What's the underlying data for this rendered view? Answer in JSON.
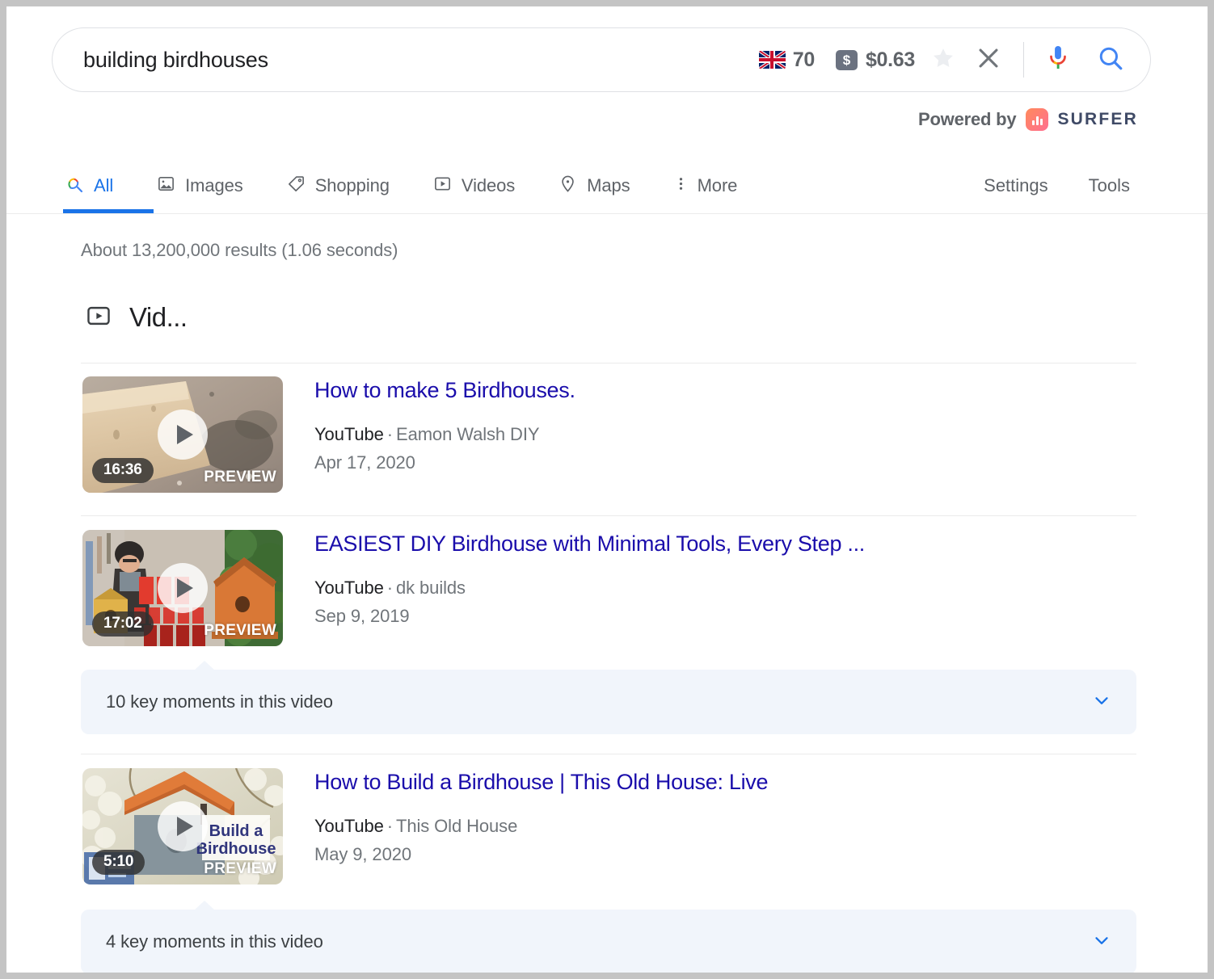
{
  "search": {
    "query": "building birdhouses",
    "placeholder": "Search",
    "metrics": {
      "flag_label": "70",
      "price_label": "$0.63",
      "dollar_glyph": "$"
    }
  },
  "powered_by": {
    "prefix": "Powered by",
    "brand": "SURFER"
  },
  "nav": {
    "tabs": [
      {
        "label": "All",
        "icon": "google-search-icon",
        "active": true
      },
      {
        "label": "Images",
        "icon": "image-icon",
        "active": false
      },
      {
        "label": "Shopping",
        "icon": "tag-icon",
        "active": false
      },
      {
        "label": "Videos",
        "icon": "video-icon",
        "active": false
      },
      {
        "label": "Maps",
        "icon": "map-pin-icon",
        "active": false
      },
      {
        "label": "More",
        "icon": "more-vertical-icon",
        "active": false
      }
    ],
    "tools": [
      {
        "label": "Settings"
      },
      {
        "label": "Tools"
      }
    ]
  },
  "results": {
    "count_text": "About 13,200,000 results (1.06 seconds)",
    "section_title": "Vid...",
    "videos": [
      {
        "title": "How to make 5 Birdhouses.",
        "source": "YouTube",
        "separator": "·",
        "channel": "Eamon Walsh DIY",
        "date": "Apr 17, 2020",
        "duration": "16:36",
        "preview_label": "PREVIEW",
        "key_moments": null
      },
      {
        "title": "EASIEST DIY Birdhouse with Minimal Tools, Every Step ...",
        "source": "YouTube",
        "separator": "·",
        "channel": "dk builds",
        "date": "Sep 9, 2019",
        "duration": "17:02",
        "preview_label": "PREVIEW",
        "key_moments": "10 key moments in this video"
      },
      {
        "title": "How to Build a Birdhouse | This Old House: Live",
        "source": "YouTube",
        "separator": "·",
        "channel": "This Old House",
        "date": "May 9, 2020",
        "duration": "5:10",
        "preview_label": "PREVIEW",
        "key_moments": "4 key moments in this video"
      }
    ]
  },
  "colors": {
    "link": "#1a0dab",
    "accent_blue": "#1a73e8",
    "text_gray": "#70757a",
    "keymoment_bg": "#f1f5fb",
    "surfer_gradient_start": "#ff8a5b",
    "surfer_gradient_end": "#ff6f91"
  }
}
